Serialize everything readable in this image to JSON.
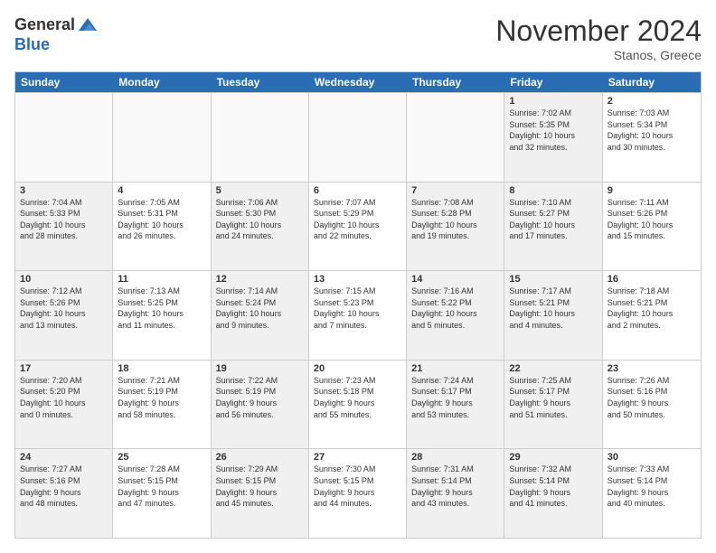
{
  "header": {
    "logo_general": "General",
    "logo_blue": "Blue",
    "month_title": "November 2024",
    "location": "Stanos, Greece"
  },
  "weekdays": [
    "Sunday",
    "Monday",
    "Tuesday",
    "Wednesday",
    "Thursday",
    "Friday",
    "Saturday"
  ],
  "weeks": [
    [
      {
        "day": "",
        "info": "",
        "empty": true
      },
      {
        "day": "",
        "info": "",
        "empty": true
      },
      {
        "day": "",
        "info": "",
        "empty": true
      },
      {
        "day": "",
        "info": "",
        "empty": true
      },
      {
        "day": "",
        "info": "",
        "empty": true
      },
      {
        "day": "1",
        "info": "Sunrise: 7:02 AM\nSunset: 5:35 PM\nDaylight: 10 hours\nand 32 minutes.",
        "shaded": true
      },
      {
        "day": "2",
        "info": "Sunrise: 7:03 AM\nSunset: 5:34 PM\nDaylight: 10 hours\nand 30 minutes."
      }
    ],
    [
      {
        "day": "3",
        "info": "Sunrise: 7:04 AM\nSunset: 5:33 PM\nDaylight: 10 hours\nand 28 minutes.",
        "shaded": true
      },
      {
        "day": "4",
        "info": "Sunrise: 7:05 AM\nSunset: 5:31 PM\nDaylight: 10 hours\nand 26 minutes."
      },
      {
        "day": "5",
        "info": "Sunrise: 7:06 AM\nSunset: 5:30 PM\nDaylight: 10 hours\nand 24 minutes.",
        "shaded": true
      },
      {
        "day": "6",
        "info": "Sunrise: 7:07 AM\nSunset: 5:29 PM\nDaylight: 10 hours\nand 22 minutes."
      },
      {
        "day": "7",
        "info": "Sunrise: 7:08 AM\nSunset: 5:28 PM\nDaylight: 10 hours\nand 19 minutes.",
        "shaded": true
      },
      {
        "day": "8",
        "info": "Sunrise: 7:10 AM\nSunset: 5:27 PM\nDaylight: 10 hours\nand 17 minutes.",
        "shaded": true
      },
      {
        "day": "9",
        "info": "Sunrise: 7:11 AM\nSunset: 5:26 PM\nDaylight: 10 hours\nand 15 minutes."
      }
    ],
    [
      {
        "day": "10",
        "info": "Sunrise: 7:12 AM\nSunset: 5:26 PM\nDaylight: 10 hours\nand 13 minutes.",
        "shaded": true
      },
      {
        "day": "11",
        "info": "Sunrise: 7:13 AM\nSunset: 5:25 PM\nDaylight: 10 hours\nand 11 minutes."
      },
      {
        "day": "12",
        "info": "Sunrise: 7:14 AM\nSunset: 5:24 PM\nDaylight: 10 hours\nand 9 minutes.",
        "shaded": true
      },
      {
        "day": "13",
        "info": "Sunrise: 7:15 AM\nSunset: 5:23 PM\nDaylight: 10 hours\nand 7 minutes."
      },
      {
        "day": "14",
        "info": "Sunrise: 7:16 AM\nSunset: 5:22 PM\nDaylight: 10 hours\nand 5 minutes.",
        "shaded": true
      },
      {
        "day": "15",
        "info": "Sunrise: 7:17 AM\nSunset: 5:21 PM\nDaylight: 10 hours\nand 4 minutes.",
        "shaded": true
      },
      {
        "day": "16",
        "info": "Sunrise: 7:18 AM\nSunset: 5:21 PM\nDaylight: 10 hours\nand 2 minutes."
      }
    ],
    [
      {
        "day": "17",
        "info": "Sunrise: 7:20 AM\nSunset: 5:20 PM\nDaylight: 10 hours\nand 0 minutes.",
        "shaded": true
      },
      {
        "day": "18",
        "info": "Sunrise: 7:21 AM\nSunset: 5:19 PM\nDaylight: 9 hours\nand 58 minutes."
      },
      {
        "day": "19",
        "info": "Sunrise: 7:22 AM\nSunset: 5:19 PM\nDaylight: 9 hours\nand 56 minutes.",
        "shaded": true
      },
      {
        "day": "20",
        "info": "Sunrise: 7:23 AM\nSunset: 5:18 PM\nDaylight: 9 hours\nand 55 minutes."
      },
      {
        "day": "21",
        "info": "Sunrise: 7:24 AM\nSunset: 5:17 PM\nDaylight: 9 hours\nand 53 minutes.",
        "shaded": true
      },
      {
        "day": "22",
        "info": "Sunrise: 7:25 AM\nSunset: 5:17 PM\nDaylight: 9 hours\nand 51 minutes.",
        "shaded": true
      },
      {
        "day": "23",
        "info": "Sunrise: 7:26 AM\nSunset: 5:16 PM\nDaylight: 9 hours\nand 50 minutes."
      }
    ],
    [
      {
        "day": "24",
        "info": "Sunrise: 7:27 AM\nSunset: 5:16 PM\nDaylight: 9 hours\nand 48 minutes.",
        "shaded": true
      },
      {
        "day": "25",
        "info": "Sunrise: 7:28 AM\nSunset: 5:15 PM\nDaylight: 9 hours\nand 47 minutes."
      },
      {
        "day": "26",
        "info": "Sunrise: 7:29 AM\nSunset: 5:15 PM\nDaylight: 9 hours\nand 45 minutes.",
        "shaded": true
      },
      {
        "day": "27",
        "info": "Sunrise: 7:30 AM\nSunset: 5:15 PM\nDaylight: 9 hours\nand 44 minutes."
      },
      {
        "day": "28",
        "info": "Sunrise: 7:31 AM\nSunset: 5:14 PM\nDaylight: 9 hours\nand 43 minutes.",
        "shaded": true
      },
      {
        "day": "29",
        "info": "Sunrise: 7:32 AM\nSunset: 5:14 PM\nDaylight: 9 hours\nand 41 minutes.",
        "shaded": true
      },
      {
        "day": "30",
        "info": "Sunrise: 7:33 AM\nSunset: 5:14 PM\nDaylight: 9 hours\nand 40 minutes."
      }
    ]
  ]
}
